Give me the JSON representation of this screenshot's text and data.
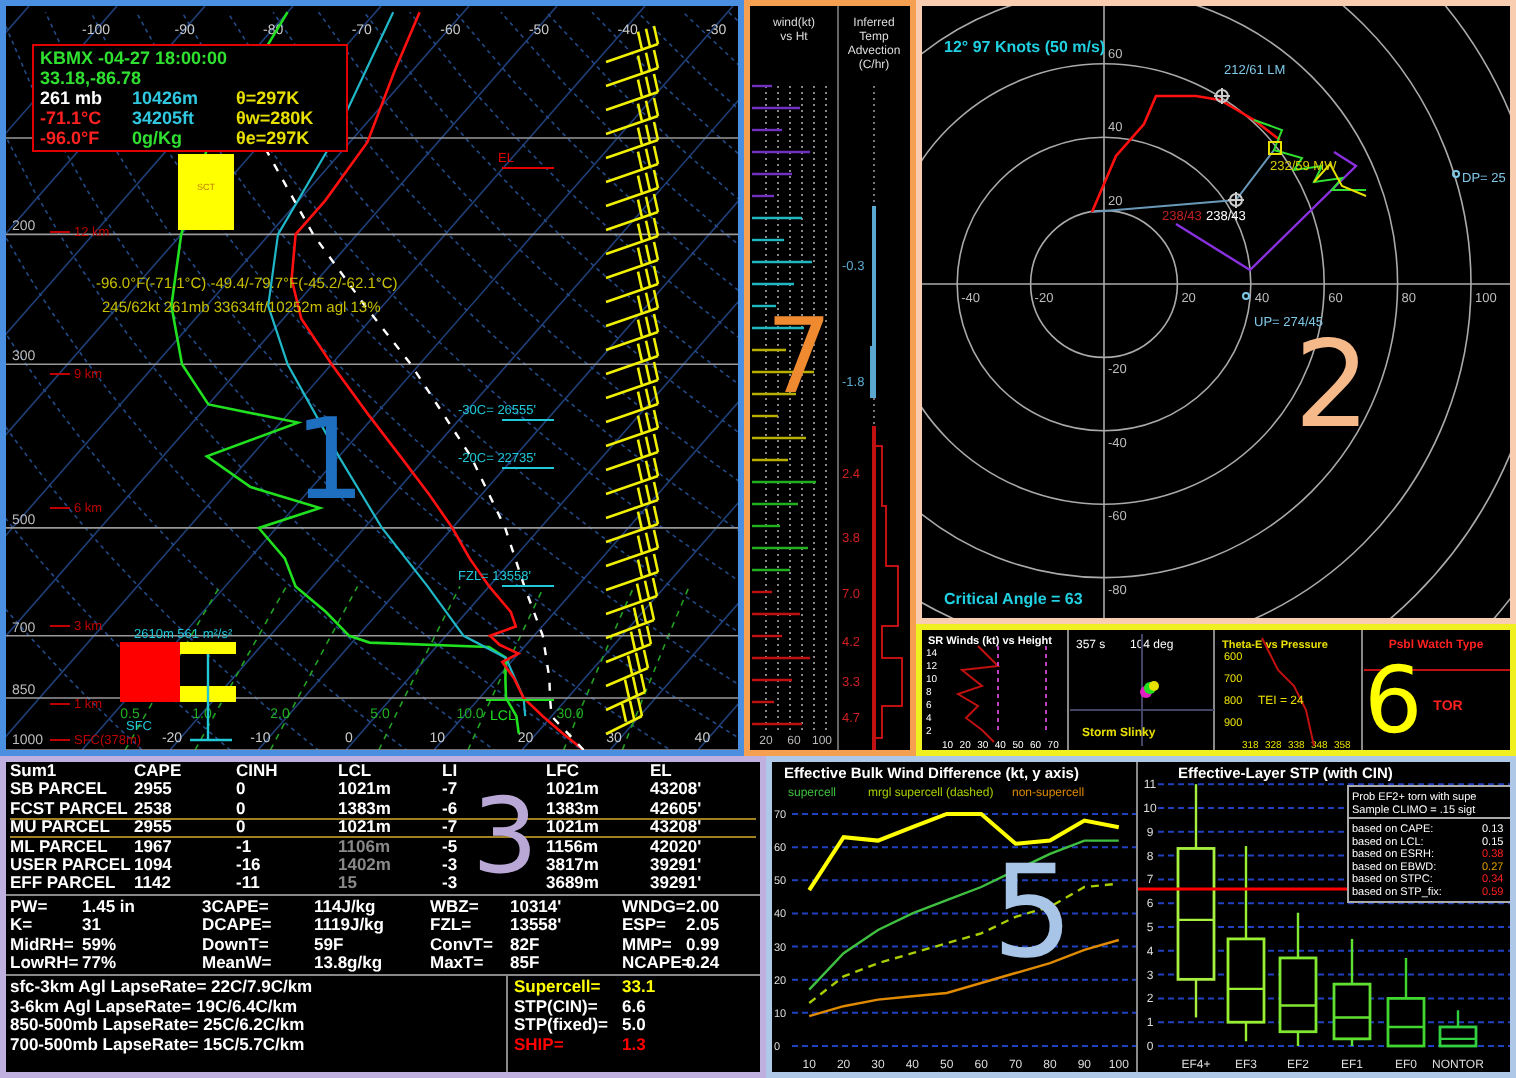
{
  "skewt": {
    "panel_number": "1",
    "top_ticks": [
      "-100",
      "-90",
      "-80",
      "-70",
      "-60",
      "-50",
      "-40",
      "-30"
    ],
    "bottom_ticks": [
      "-20",
      "-10",
      "0",
      "10",
      "20",
      "30",
      "40"
    ],
    "mixing_ratio_labels": [
      "0.5",
      "1.0",
      "2.0",
      "5.0",
      "10.0",
      "30.0"
    ],
    "pressure_labels": [
      "200",
      "300",
      "500",
      "700",
      "850",
      "1000"
    ],
    "height_labels": [
      "12 km",
      "9 km",
      "6 km",
      "3 km",
      "1 km",
      "SFC(378m)"
    ],
    "readout": {
      "station": "KBMX -04-27 18:00:00",
      "location": "33.18,-86.78",
      "rows": [
        [
          "261 mb",
          "10426m",
          "θ=297K"
        ],
        [
          "-71.1°C",
          "34205ft",
          "θw=280K"
        ],
        [
          "-96.0°F",
          "0g/Kg",
          "θe=297K"
        ]
      ]
    },
    "cursor_lines": [
      "-96.0°F(-71.1°C) -49.4/-79.7°F(-45.2/-62.1°C)",
      "245/62kt  261mb  33634ft/10252m agl  13%"
    ],
    "cloud_label": "SCT",
    "el_label": "EL",
    "lcl_label": "LCL",
    "level_labels": [
      "-30C= 26555'",
      "-20C= 22735'",
      "FZL= 13558'"
    ],
    "helicity_label": "2610m 561 m²/s²",
    "sfc_label": "SFC"
  },
  "advection": {
    "panel_number": "7",
    "wind_header": [
      "wind(kt)",
      "vs Ht"
    ],
    "advection_header": [
      "Inferred",
      "Temp",
      "Advection",
      "(C/hr)"
    ],
    "values": [
      "-0.3",
      "-1.8",
      "2.4",
      "3.8",
      "7.0",
      "4.2",
      "3.3",
      "4.7"
    ],
    "speed_ticks": [
      "20",
      "60",
      "100"
    ]
  },
  "hodograph": {
    "panel_number": "2",
    "title": "12°  97 Knots (50 m/s)",
    "x_labels": [
      "-40",
      "-20",
      "20",
      "40",
      "60",
      "80",
      "100"
    ],
    "y_labels": [
      "60",
      "40",
      "20",
      "-20",
      "-40",
      "-60",
      "-80"
    ],
    "point_labels": [
      {
        "text": "212/61 LM",
        "color": "#7fc8e8"
      },
      {
        "text": "232/59 MW",
        "color": "#d8d000"
      },
      {
        "text": "238/43",
        "color": "#c02020"
      },
      {
        "text": "238/43",
        "color": "#ffffff"
      },
      {
        "text": "DP= 25",
        "color": "#7fc8e8"
      },
      {
        "text": "UP= 274/45",
        "color": "#7fc8e8"
      }
    ],
    "critical_angle": "Critical Angle = 63"
  },
  "insets": {
    "panel_number": "6",
    "sr_winds": {
      "title": "SR Winds (kt) vs Height",
      "y_ticks": [
        "14",
        "12",
        "10",
        "8",
        "6",
        "4",
        "2"
      ],
      "x_ticks": [
        "10",
        "20",
        "30",
        "40",
        "50",
        "60",
        "70"
      ]
    },
    "slinky": {
      "time": "357 s",
      "direction": "104 deg",
      "title": "Storm Slinky"
    },
    "theta_e": {
      "title": "Theta-E vs Pressure",
      "y_ticks": [
        "600",
        "700",
        "800",
        "900"
      ],
      "x_ticks": [
        "318",
        "328",
        "338",
        "348",
        "358"
      ],
      "tei": "TEI = 24"
    },
    "watch": {
      "title": "Psbl Watch Type",
      "type": "TOR"
    }
  },
  "summary": {
    "panel_number": "3",
    "columns": [
      "Sum1",
      "CAPE",
      "CINH",
      "LCL",
      "LI",
      "LFC",
      "EL"
    ],
    "parcels": [
      {
        "cells": [
          "SB PARCEL",
          "2955",
          "0",
          "1021m",
          "-7",
          "1021m",
          "43208'"
        ],
        "selected": false,
        "lcl_greyed": false
      },
      {
        "cells": [
          "FCST PARCEL",
          "2538",
          "0",
          "1383m",
          "-6",
          "1383m",
          "42605'"
        ],
        "selected": false,
        "lcl_greyed": false
      },
      {
        "cells": [
          "MU PARCEL",
          "2955",
          "0",
          "1021m",
          "-7",
          "1021m",
          "43208'"
        ],
        "selected": true,
        "lcl_greyed": false
      },
      {
        "cells": [
          "ML PARCEL",
          "1967",
          "-1",
          "1106m",
          "-5",
          "1156m",
          "42020'"
        ],
        "selected": false,
        "lcl_greyed": true
      },
      {
        "cells": [
          "USER PARCEL",
          "1094",
          "-16",
          "1402m",
          "-3",
          "3817m",
          "39291'"
        ],
        "selected": false,
        "lcl_greyed": true
      },
      {
        "cells": [
          "EFF PARCEL",
          "1142",
          "-11",
          "15",
          "-3",
          "3689m",
          "39291'"
        ],
        "selected": false,
        "lcl_greyed": true
      }
    ],
    "indices": [
      [
        {
          "label": "PW=",
          "value": "1.45 in"
        },
        {
          "label": "3CAPE=",
          "value": "114J/kg"
        },
        {
          "label": "WBZ=",
          "value": "10314'"
        },
        {
          "label": "WNDG=",
          "value": "2.00"
        }
      ],
      [
        {
          "label": "K=",
          "value": "31"
        },
        {
          "label": "DCAPE=",
          "value": "1119J/kg"
        },
        {
          "label": "FZL=",
          "value": "13558'"
        },
        {
          "label": "ESP=",
          "value": "2.05"
        }
      ],
      [
        {
          "label": "MidRH=",
          "value": "59%"
        },
        {
          "label": "DownT=",
          "value": "59F"
        },
        {
          "label": "ConvT=",
          "value": "82F"
        },
        {
          "label": "MMP=",
          "value": "0.99"
        }
      ],
      [
        {
          "label": "LowRH=",
          "value": "77%"
        },
        {
          "label": "MeanW=",
          "value": "13.8g/kg"
        },
        {
          "label": "MaxT=",
          "value": "85F"
        },
        {
          "label": "NCAPE=",
          "value": "0.24"
        }
      ]
    ],
    "lapse_rates": [
      "sfc-3km Agl LapseRate= 22C/7.9C/km",
      "3-6km Agl LapseRate= 19C/6.4C/km",
      "850-500mb LapseRate= 25C/6.2C/km",
      "700-500mb LapseRate= 15C/5.7C/km"
    ],
    "composites": [
      {
        "label": "Supercell=",
        "value": "33.1",
        "color": "#ffff00"
      },
      {
        "label": "STP(CIN)=",
        "value": "6.6",
        "color": "#ffffff"
      },
      {
        "label": "STP(fixed)=",
        "value": "5.0",
        "color": "#ffffff"
      },
      {
        "label": "SHIP=",
        "value": "1.3",
        "color": "#ff0000"
      }
    ]
  },
  "bulk_shear": {
    "panel_number": "5",
    "chart_data": {
      "type": "line",
      "title": "Effective Bulk Wind Difference (kt, y axis)",
      "x": [
        10,
        20,
        30,
        40,
        50,
        60,
        70,
        80,
        90,
        100
      ],
      "xlim": [
        5,
        105
      ],
      "grid": true,
      "xticks": [
        10,
        20,
        30,
        40,
        50,
        60,
        70,
        80,
        90,
        100
      ],
      "ylim": [
        0,
        70
      ],
      "yticks": [
        0,
        10,
        20,
        30,
        40,
        50,
        60,
        70
      ],
      "series": [
        {
          "color": "#ffff00",
          "values": [
            47,
            63,
            62,
            66,
            70,
            70,
            61,
            62,
            68,
            66
          ]
        },
        {
          "name": "supercell",
          "color": "#40c040",
          "values": [
            17,
            28,
            35,
            40,
            44,
            48,
            53,
            58,
            62,
            62
          ]
        },
        {
          "name": "mrgl supercell (dashed)",
          "color": "#a8d000",
          "line_style": "dashed",
          "values": [
            13,
            21,
            25,
            28,
            31,
            34,
            39,
            42,
            48,
            49
          ]
        },
        {
          "name": "non-supercell",
          "color": "#e08a00",
          "values": [
            9,
            12,
            14,
            15,
            16,
            19,
            22,
            25,
            29,
            32
          ]
        }
      ]
    }
  },
  "stp": {
    "title": "Effective-Layer STP (with CIN)",
    "y_ticks": [
      "11",
      "10",
      "9",
      "8",
      "7",
      "6",
      "5",
      "4",
      "3",
      "2",
      "1",
      "0"
    ],
    "categories": [
      "EF4+",
      "EF3",
      "EF2",
      "EF1",
      "EF0",
      "NONTOR"
    ],
    "prob_header": [
      "Prob EF2+ torn with supe",
      "Sample CLIMO = .15 sigt"
    ],
    "prob_rows": [
      {
        "label": "based on CAPE:",
        "value": "0.13",
        "color": "#ffffff"
      },
      {
        "label": "based on LCL:",
        "value": "0.15",
        "color": "#ffffff"
      },
      {
        "label": "based on ESRH:",
        "value": "0.38",
        "color": "#ff2020"
      },
      {
        "label": "based on EBWD:",
        "value": "0.27",
        "color": "#e0a000"
      },
      {
        "label": "based on STPC:",
        "value": "0.34",
        "color": "#ff2020"
      },
      {
        "label": "based on STP_fix:",
        "value": "0.59",
        "color": "#ff2020"
      }
    ]
  }
}
